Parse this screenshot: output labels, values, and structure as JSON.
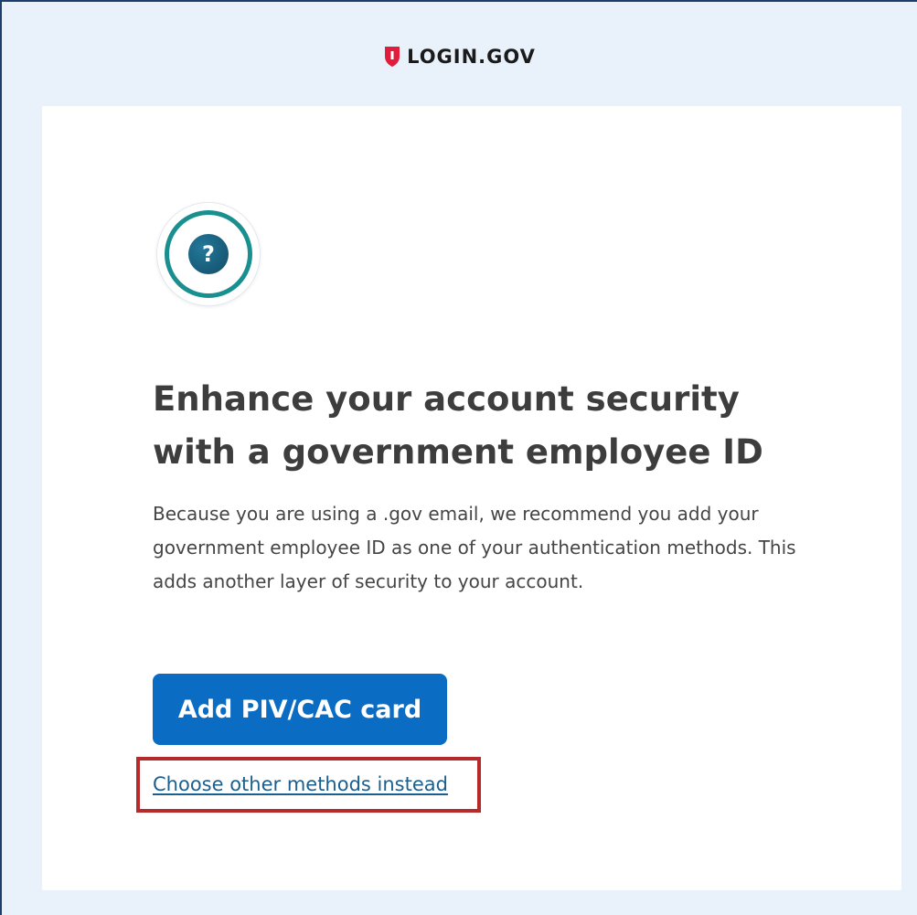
{
  "header": {
    "logo_text": "LOGIN.GOV",
    "logo_icon": "shield-icon"
  },
  "main": {
    "badge_icon": "question-mark-icon",
    "badge_glyph": "?",
    "heading": "Enhance your account security with a government employee ID",
    "body": "Because you are using a .gov email, we recommend you add your government employee ID as one of your authentication methods. This adds another layer of security to your account.",
    "primary_button_label": "Add PIV/CAC card",
    "secondary_link_label": "Choose other methods instead"
  },
  "colors": {
    "brand_red": "#e21c3d",
    "primary_blue": "#0a6cc2",
    "link_blue": "#1c5f8f",
    "teal_ring": "#1a8f8f",
    "highlight_red": "#b52b2b",
    "page_background": "#e9f2fb"
  }
}
